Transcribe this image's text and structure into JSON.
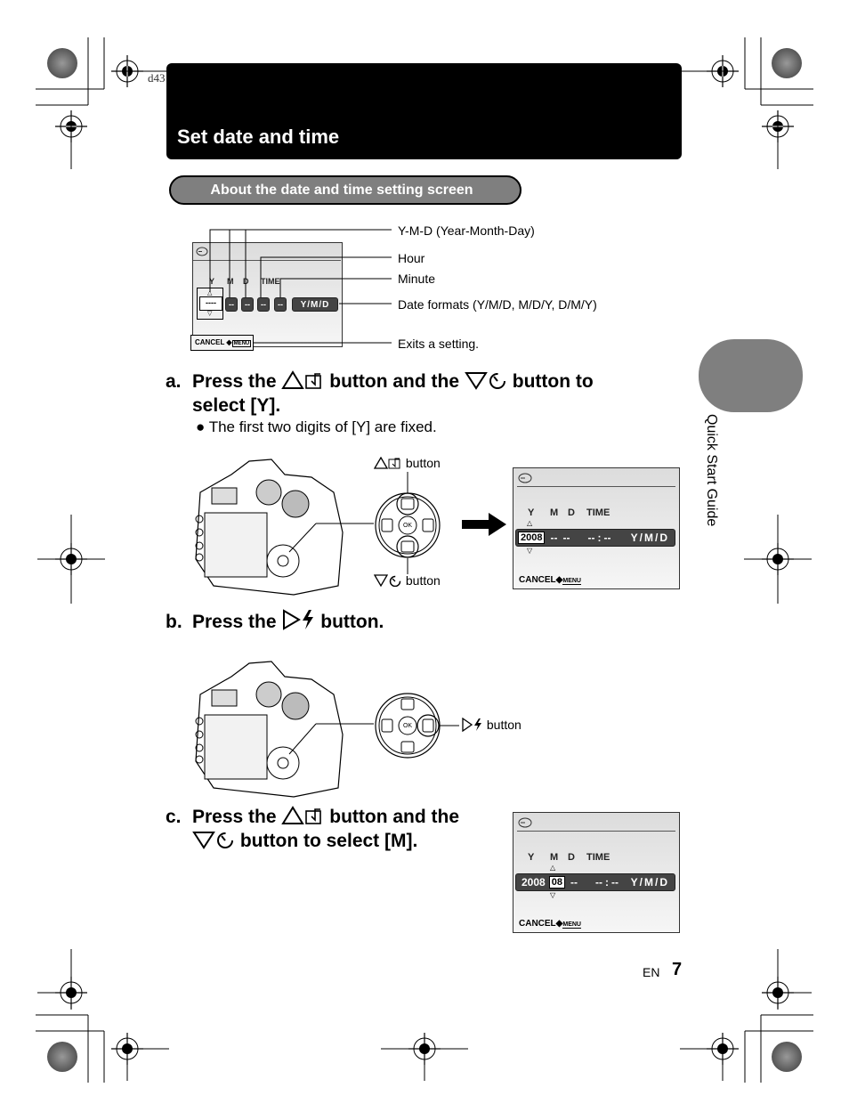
{
  "doc_id": "d43",
  "header": {
    "title": "Set date and time"
  },
  "section_pill": {
    "label": "About the date and time setting screen"
  },
  "diagram": {
    "lcd_labels": {
      "y": "Y",
      "m": "M",
      "d": "D",
      "time": "TIME",
      "placeholder_year": "----",
      "placeholder_2": "--",
      "format": "Y/M/D",
      "cancel": "CANCEL",
      "menu": "MENU"
    },
    "callouts": [
      "Y-M-D (Year-Month-Day)",
      "Hour",
      "Minute",
      "Date formats (Y/M/D, M/D/Y, D/M/Y)",
      "Exits a setting."
    ]
  },
  "steps": {
    "a": {
      "letter": "a.",
      "line1_pre": "Press the",
      "line1_mid": "button and the",
      "line1_post": "button to",
      "line2": "select [Y].",
      "bullet": "The first two digits of [Y] are fixed.",
      "up_button_label": "button",
      "down_button_label": "button",
      "lcd": {
        "y": "Y",
        "m": "M",
        "d": "D",
        "time": "TIME",
        "year": "2008",
        "month": "--",
        "day": "--",
        "hour": "--",
        "minute": "--",
        "format": "Y/M/D",
        "cancel": "CANCEL",
        "menu": "MENU"
      }
    },
    "b": {
      "letter": "b.",
      "pre": "Press the",
      "post": "button.",
      "right_button_label": "button"
    },
    "c": {
      "letter": "c.",
      "line1_pre": "Press the",
      "line1_post": "button and the",
      "line2_post": "button to select [M].",
      "lcd": {
        "y": "Y",
        "m": "M",
        "d": "D",
        "time": "TIME",
        "year": "2008",
        "month": "08",
        "day": "--",
        "hour": "--",
        "minute": "--",
        "format": "Y/M/D",
        "cancel": "CANCEL",
        "menu": "MENU"
      }
    }
  },
  "side_tab": {
    "label": "Quick Start Guide"
  },
  "footer": {
    "lang": "EN",
    "page": "7"
  },
  "colors": {
    "tab_gray": "#7f7f7f",
    "lcd_bar": "#444444"
  }
}
